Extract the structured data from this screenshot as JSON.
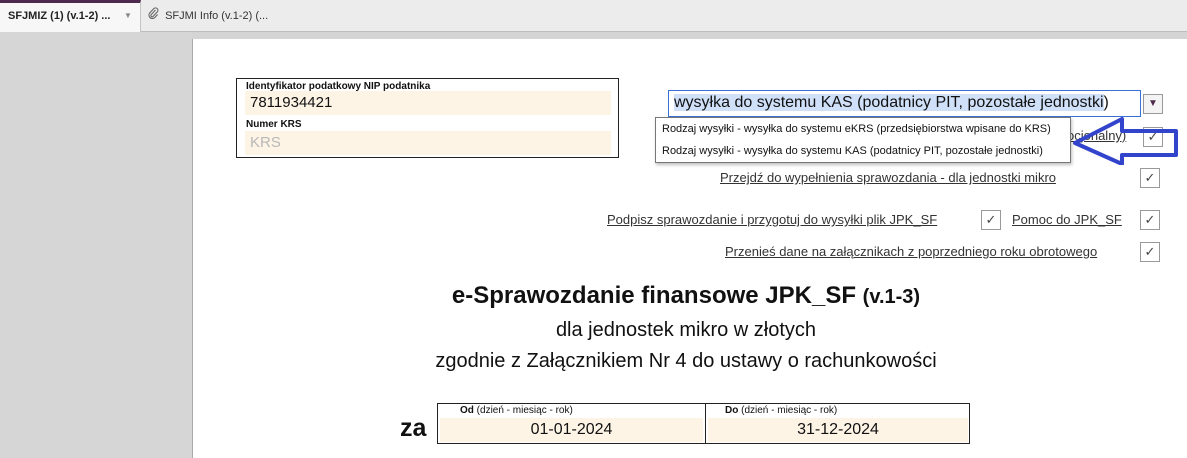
{
  "tabs": [
    {
      "label": "SFJMIZ (1) (v.1-2) ...",
      "active": true,
      "chevron": "▼"
    },
    {
      "label": "SFJMI Info (v.1-2) (...",
      "active": false,
      "icon": "paperclip-icon"
    }
  ],
  "form": {
    "nip": {
      "label": "Identyfikator podatkowy NIP podatnika",
      "value": "7811934421"
    },
    "krs": {
      "label": "Numer KRS",
      "placeholder": "KRS"
    },
    "submission_select": {
      "prefix": "wysyłka do systemu KAS (podatnicy PIT, pozostałe jednostki",
      "suffix": ")",
      "options": [
        "Rodzaj wysyłki - wysyłka do systemu eKRS (przedsiębiorstwa wpisane do KRS)",
        "Rodzaj wysyłki - wysyłka do systemu KAS (podatnicy PIT, pozostałe jednostki)"
      ]
    },
    "hidden_link_fragment": "ocjonalny)",
    "links": {
      "go_micro": "Przejdź do wypełnienia sprawozdania - dla jednostki mikro",
      "sign": "Podpisz sprawozdanie i przygotuj do wysyłki plik JPK_SF",
      "help": "Pomoc do JPK_SF",
      "transfer": "Przenieś dane na załącznikach z poprzedniego roku obrotowego"
    },
    "check_glyph": "✓",
    "dropdown_glyph": "▼"
  },
  "document": {
    "title": "e-Sprawozdanie finansowe JPK_SF",
    "version": "(v.1-3)",
    "subtitle1": "dla jednostek mikro w złotych",
    "subtitle2": "zgodnie z Załącznikiem Nr 4 do ustawy o rachunkowości",
    "period": {
      "za": "za",
      "from_label_bold": "Od",
      "from_label_rest": "(dzień - miesiąc - rok)",
      "from_value": "01-01-2024",
      "to_label_bold": "Do",
      "to_label_rest": "(dzień - miesiąc - rok)",
      "to_value": "31-12-2024"
    }
  },
  "colors": {
    "accent": "#4d2a4d",
    "focus_border": "#3a6fd8",
    "input_bg": "#fdf4e6",
    "arrow": "#3344cc"
  }
}
